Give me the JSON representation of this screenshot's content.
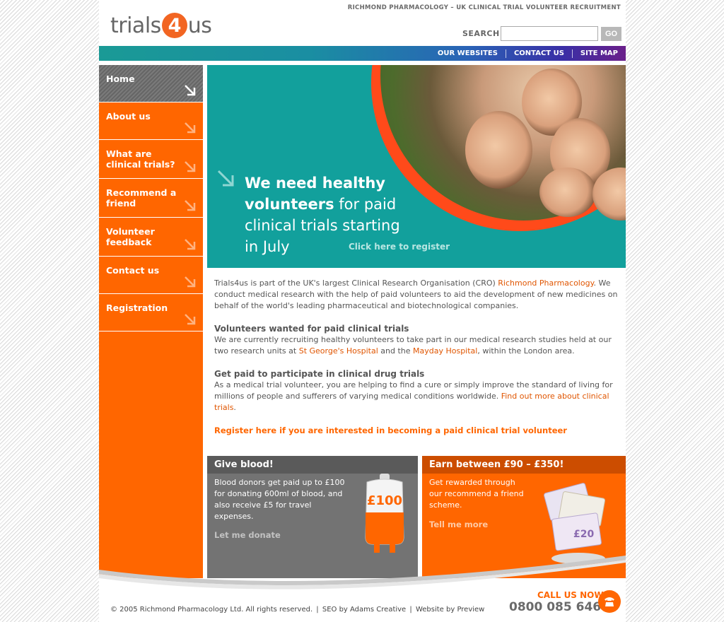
{
  "header": {
    "logo_left": "trials",
    "logo_mid": "4",
    "logo_right": "us",
    "tagline": "RICHMOND PHARMACOLOGY – UK CLINICAL TRIAL VOLUNTEER RECRUITMENT",
    "search_label": "SEARCH",
    "search_placeholder": "",
    "go_label": "GO"
  },
  "topnav": [
    "OUR WEBSITES",
    "CONTACT US",
    "SITE MAP"
  ],
  "sidebar": {
    "items": [
      {
        "label": "Home",
        "active": true
      },
      {
        "label": "About us"
      },
      {
        "label": "What are clinical trials?"
      },
      {
        "label": "Recommend a friend"
      },
      {
        "label": "Volunteer feedback"
      },
      {
        "label": "Contact us"
      },
      {
        "label": "Registration"
      }
    ]
  },
  "hero": {
    "line1_bold": "We need healthy",
    "line2_bold": "volunteers",
    "line2_rest": " for paid",
    "line3": "clinical trials starting",
    "line4": "in July",
    "register_link": "Click here to register"
  },
  "content": {
    "intro_1": "Trials4us is part of the UK's largest Clinical Research Organisation (CRO) ",
    "intro_link": "Richmond Pharmacology",
    "intro_2": ". We conduct medical research with the help of paid volunteers to aid the development of new medicines on behalf of the world's leading pharmaceutical and biotechnological companies.",
    "section1_title": "Volunteers wanted for paid clinical trials",
    "section1_text_1": "We are currently recruiting healthy volunteers to take part in our medical research studies held at our two research units at ",
    "section1_link1": "St George's Hospital",
    "section1_text_2": " and the ",
    "section1_link2": "Mayday Hospital",
    "section1_text_3": ", within the London area.",
    "section2_title": "Get paid to participate in clinical drug trials",
    "section2_text": "As a medical trial volunteer, you are helping to find a cure or simply improve the standard of living for millions of people and sufferers of varying medical conditions worldwide. ",
    "section2_link": "Find out more about clinical trials",
    "section2_end": ".",
    "register_cta": "Register here if you are interested in becoming a paid clinical trial volunteer"
  },
  "promo_blood": {
    "title": "Give blood!",
    "text": "Blood donors get paid up to £100 for donating 600ml of blood, and also receive £5 for travel expenses.",
    "link": "Let me donate",
    "bag_label": "£100"
  },
  "promo_earn": {
    "title": "Earn between £90 – £350!",
    "text": "Get rewarded through our recommend a friend scheme.",
    "link": "Tell me more"
  },
  "footer": {
    "copyright": "© 2005 Richmond Pharmacology Ltd. All rights reserved.",
    "seo": "SEO by Adams Creative",
    "website": "Website by Preview",
    "call_label": "CALL US NOW",
    "call_number": "0800 085 6464"
  },
  "colors": {
    "brand_orange": "#ff6600",
    "teal": "#12a09c",
    "grey": "#737373"
  }
}
